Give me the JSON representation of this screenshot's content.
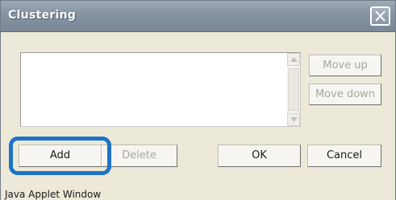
{
  "window": {
    "title": "Clustering"
  },
  "buttons": {
    "move_up": "Move up",
    "move_down": "Move down",
    "add": "Add",
    "delete": "Delete",
    "ok": "OK",
    "cancel": "Cancel"
  },
  "status": {
    "text": "Java Applet Window"
  },
  "icons": {
    "close": "close-icon",
    "scroll_up": "scroll-up-arrow-icon",
    "scroll_down": "scroll-down-arrow-icon"
  },
  "colors": {
    "titlebar": "#8592a1",
    "highlight": "#1d73c6",
    "dialog_background": "#ece9d8"
  }
}
